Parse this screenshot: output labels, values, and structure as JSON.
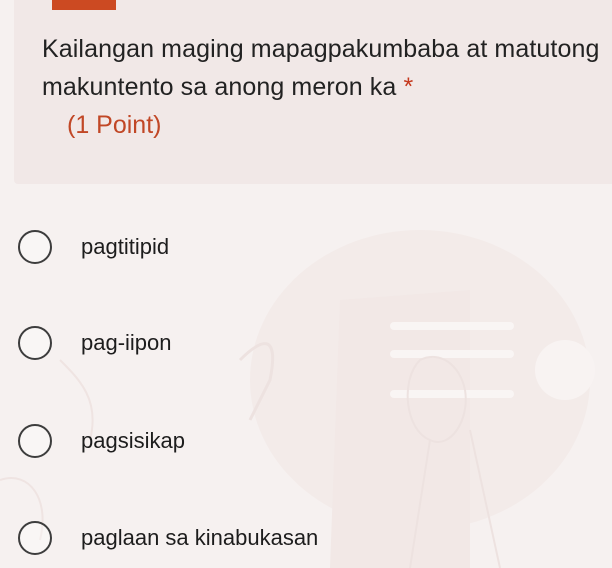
{
  "question": {
    "text": "Kailangan maging mapagpakumbaba at matutong makuntento sa anong meron ka",
    "required_marker": "*",
    "points": "(1 Point)"
  },
  "options": [
    {
      "label": "pagtitipid"
    },
    {
      "label": "pag-iipon"
    },
    {
      "label": "pagsisikap"
    },
    {
      "label": "paglaan sa kinabukasan"
    }
  ],
  "colors": {
    "accent": "#cc4a22",
    "points": "#c14726",
    "card_background": "#f1e8e7",
    "page_background": "#f6f1f0"
  }
}
